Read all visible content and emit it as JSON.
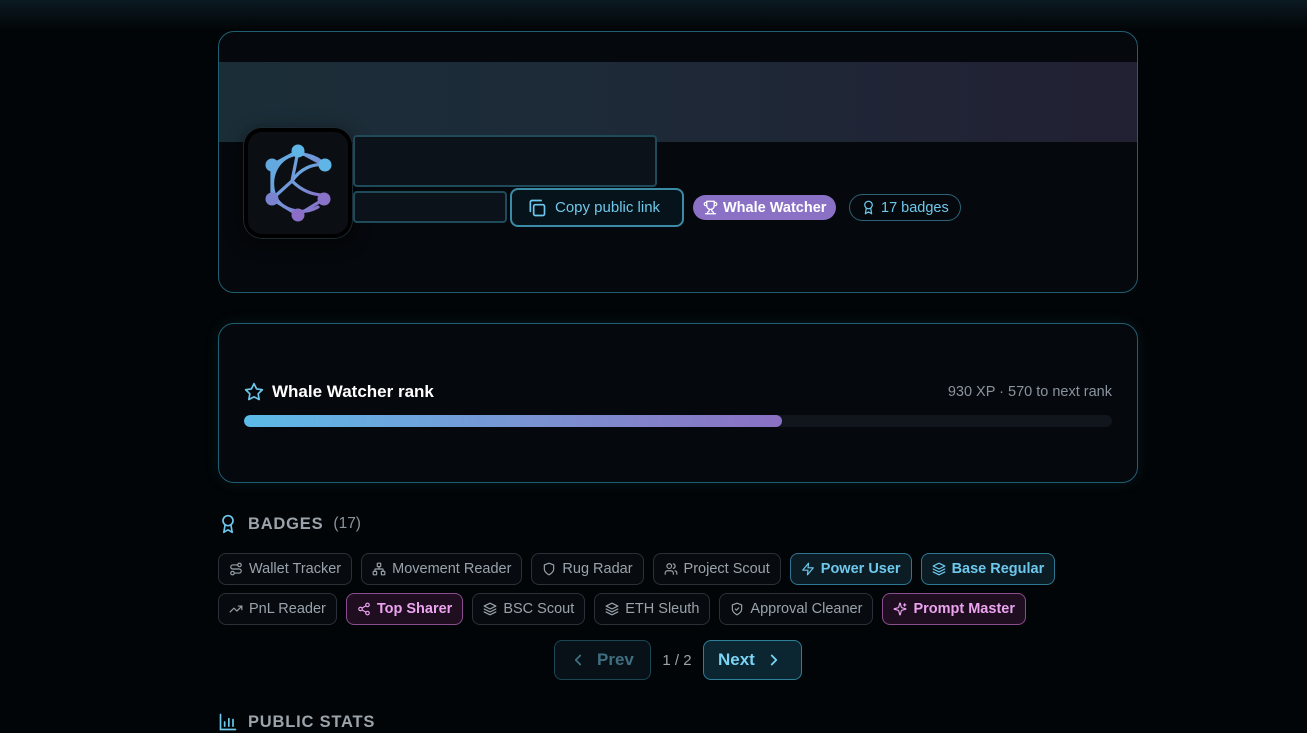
{
  "profile": {
    "copy_link_label": "Copy public link",
    "rank_pill": "Whale Watcher",
    "badges_pill": "17 badges"
  },
  "rank": {
    "title": "Whale Watcher rank",
    "xp_text": "930 XP · 570 to next rank",
    "progress_percent": 62
  },
  "badges": {
    "heading": "BADGES",
    "count": "(17)",
    "row1": [
      {
        "label": "Wallet Tracker",
        "icon": "route-icon",
        "style": "plain"
      },
      {
        "label": "Movement Reader",
        "icon": "network-icon",
        "style": "plain"
      },
      {
        "label": "Rug Radar",
        "icon": "shield-icon",
        "style": "plain"
      },
      {
        "label": "Project Scout",
        "icon": "users-icon",
        "style": "plain"
      },
      {
        "label": "Power User",
        "icon": "bolt-icon",
        "style": "blue"
      },
      {
        "label": "Base Regular",
        "icon": "layers-icon",
        "style": "blue"
      }
    ],
    "row2": [
      {
        "label": "PnL Reader",
        "icon": "trending-up-icon",
        "style": "plain"
      },
      {
        "label": "Top Sharer",
        "icon": "share-icon",
        "style": "pink"
      },
      {
        "label": "BSC Scout",
        "icon": "layers-icon",
        "style": "plain"
      },
      {
        "label": "ETH Sleuth",
        "icon": "layers-icon",
        "style": "plain"
      },
      {
        "label": "Approval Cleaner",
        "icon": "shield-check-icon",
        "style": "plain"
      },
      {
        "label": "Prompt Master",
        "icon": "sparkles-icon",
        "style": "pink"
      }
    ]
  },
  "pagination": {
    "prev_label": "Prev",
    "next_label": "Next",
    "page_info": "1 / 2"
  },
  "public_stats": {
    "heading": "PUBLIC STATS"
  },
  "colors": {
    "accent": "#6ec8ec",
    "purple": "#8a71c6",
    "pink": "#eca4f0",
    "background": "#020507"
  }
}
